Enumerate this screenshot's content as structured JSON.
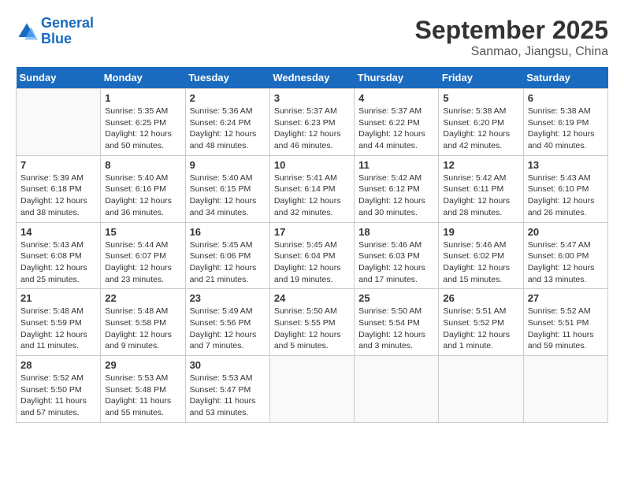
{
  "logo": {
    "general": "General",
    "blue": "Blue"
  },
  "header": {
    "month": "September 2025",
    "location": "Sanmao, Jiangsu, China"
  },
  "days_of_week": [
    "Sunday",
    "Monday",
    "Tuesday",
    "Wednesday",
    "Thursday",
    "Friday",
    "Saturday"
  ],
  "weeks": [
    [
      {
        "day": "",
        "info": ""
      },
      {
        "day": "1",
        "info": "Sunrise: 5:35 AM\nSunset: 6:25 PM\nDaylight: 12 hours\nand 50 minutes."
      },
      {
        "day": "2",
        "info": "Sunrise: 5:36 AM\nSunset: 6:24 PM\nDaylight: 12 hours\nand 48 minutes."
      },
      {
        "day": "3",
        "info": "Sunrise: 5:37 AM\nSunset: 6:23 PM\nDaylight: 12 hours\nand 46 minutes."
      },
      {
        "day": "4",
        "info": "Sunrise: 5:37 AM\nSunset: 6:22 PM\nDaylight: 12 hours\nand 44 minutes."
      },
      {
        "day": "5",
        "info": "Sunrise: 5:38 AM\nSunset: 6:20 PM\nDaylight: 12 hours\nand 42 minutes."
      },
      {
        "day": "6",
        "info": "Sunrise: 5:38 AM\nSunset: 6:19 PM\nDaylight: 12 hours\nand 40 minutes."
      }
    ],
    [
      {
        "day": "7",
        "info": "Sunrise: 5:39 AM\nSunset: 6:18 PM\nDaylight: 12 hours\nand 38 minutes."
      },
      {
        "day": "8",
        "info": "Sunrise: 5:40 AM\nSunset: 6:16 PM\nDaylight: 12 hours\nand 36 minutes."
      },
      {
        "day": "9",
        "info": "Sunrise: 5:40 AM\nSunset: 6:15 PM\nDaylight: 12 hours\nand 34 minutes."
      },
      {
        "day": "10",
        "info": "Sunrise: 5:41 AM\nSunset: 6:14 PM\nDaylight: 12 hours\nand 32 minutes."
      },
      {
        "day": "11",
        "info": "Sunrise: 5:42 AM\nSunset: 6:12 PM\nDaylight: 12 hours\nand 30 minutes."
      },
      {
        "day": "12",
        "info": "Sunrise: 5:42 AM\nSunset: 6:11 PM\nDaylight: 12 hours\nand 28 minutes."
      },
      {
        "day": "13",
        "info": "Sunrise: 5:43 AM\nSunset: 6:10 PM\nDaylight: 12 hours\nand 26 minutes."
      }
    ],
    [
      {
        "day": "14",
        "info": "Sunrise: 5:43 AM\nSunset: 6:08 PM\nDaylight: 12 hours\nand 25 minutes."
      },
      {
        "day": "15",
        "info": "Sunrise: 5:44 AM\nSunset: 6:07 PM\nDaylight: 12 hours\nand 23 minutes."
      },
      {
        "day": "16",
        "info": "Sunrise: 5:45 AM\nSunset: 6:06 PM\nDaylight: 12 hours\nand 21 minutes."
      },
      {
        "day": "17",
        "info": "Sunrise: 5:45 AM\nSunset: 6:04 PM\nDaylight: 12 hours\nand 19 minutes."
      },
      {
        "day": "18",
        "info": "Sunrise: 5:46 AM\nSunset: 6:03 PM\nDaylight: 12 hours\nand 17 minutes."
      },
      {
        "day": "19",
        "info": "Sunrise: 5:46 AM\nSunset: 6:02 PM\nDaylight: 12 hours\nand 15 minutes."
      },
      {
        "day": "20",
        "info": "Sunrise: 5:47 AM\nSunset: 6:00 PM\nDaylight: 12 hours\nand 13 minutes."
      }
    ],
    [
      {
        "day": "21",
        "info": "Sunrise: 5:48 AM\nSunset: 5:59 PM\nDaylight: 12 hours\nand 11 minutes."
      },
      {
        "day": "22",
        "info": "Sunrise: 5:48 AM\nSunset: 5:58 PM\nDaylight: 12 hours\nand 9 minutes."
      },
      {
        "day": "23",
        "info": "Sunrise: 5:49 AM\nSunset: 5:56 PM\nDaylight: 12 hours\nand 7 minutes."
      },
      {
        "day": "24",
        "info": "Sunrise: 5:50 AM\nSunset: 5:55 PM\nDaylight: 12 hours\nand 5 minutes."
      },
      {
        "day": "25",
        "info": "Sunrise: 5:50 AM\nSunset: 5:54 PM\nDaylight: 12 hours\nand 3 minutes."
      },
      {
        "day": "26",
        "info": "Sunrise: 5:51 AM\nSunset: 5:52 PM\nDaylight: 12 hours\nand 1 minute."
      },
      {
        "day": "27",
        "info": "Sunrise: 5:52 AM\nSunset: 5:51 PM\nDaylight: 11 hours\nand 59 minutes."
      }
    ],
    [
      {
        "day": "28",
        "info": "Sunrise: 5:52 AM\nSunset: 5:50 PM\nDaylight: 11 hours\nand 57 minutes."
      },
      {
        "day": "29",
        "info": "Sunrise: 5:53 AM\nSunset: 5:48 PM\nDaylight: 11 hours\nand 55 minutes."
      },
      {
        "day": "30",
        "info": "Sunrise: 5:53 AM\nSunset: 5:47 PM\nDaylight: 11 hours\nand 53 minutes."
      },
      {
        "day": "",
        "info": ""
      },
      {
        "day": "",
        "info": ""
      },
      {
        "day": "",
        "info": ""
      },
      {
        "day": "",
        "info": ""
      }
    ]
  ]
}
